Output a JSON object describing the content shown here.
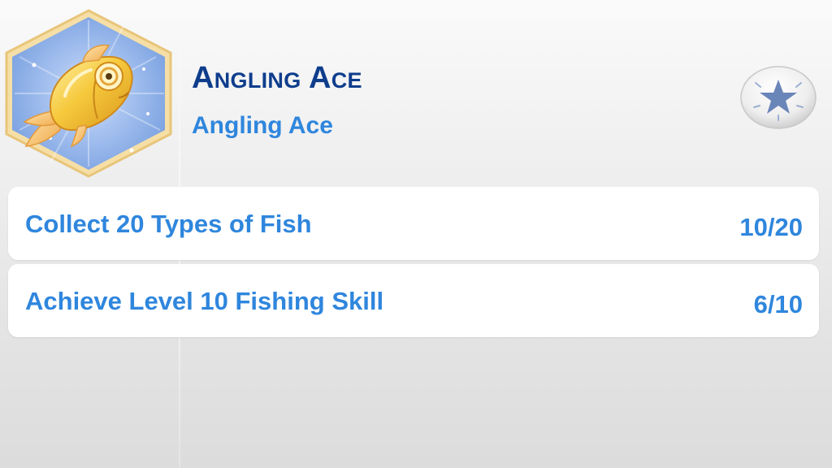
{
  "aspiration": {
    "title": "Angling Ace",
    "subtitle": "Angling Ace",
    "badge_icon": "golden-fish-icon"
  },
  "star_button": {
    "icon": "star-icon"
  },
  "goals": [
    {
      "label": "Collect 20 Types of Fish",
      "progress": "10/20",
      "current": 10,
      "total": 20
    },
    {
      "label": "Achieve Level 10 Fishing Skill",
      "progress": "6/10",
      "current": 6,
      "total": 10
    }
  ],
  "colors": {
    "title": "#0e3d8c",
    "text_accent": "#2f86dd",
    "badge_border": "#f4d99a",
    "badge_fill": "#8fb3ec",
    "fish": "#f4c53a"
  }
}
